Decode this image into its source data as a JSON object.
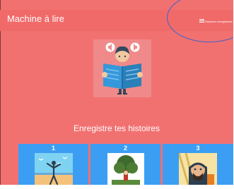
{
  "app": {
    "title": "Machine à lire"
  },
  "menu": {
    "icon": "menu-icon",
    "label": "Histoires enregistrées"
  },
  "main": {
    "hero_icon": "reader-with-book-and-speakers-icon",
    "section_title": "Enregistre tes histoires"
  },
  "stories": [
    {
      "number": "1",
      "image": "seaside-figure-with-birds-image"
    },
    {
      "number": "2",
      "image": "tree-with-figure-image"
    },
    {
      "number": "3",
      "image": "bearded-man-portrait-image"
    }
  ],
  "colors": {
    "background": "#f17171",
    "card": "#3b9ef3",
    "text": "#ffffff",
    "annotation": "#3f63c8"
  }
}
